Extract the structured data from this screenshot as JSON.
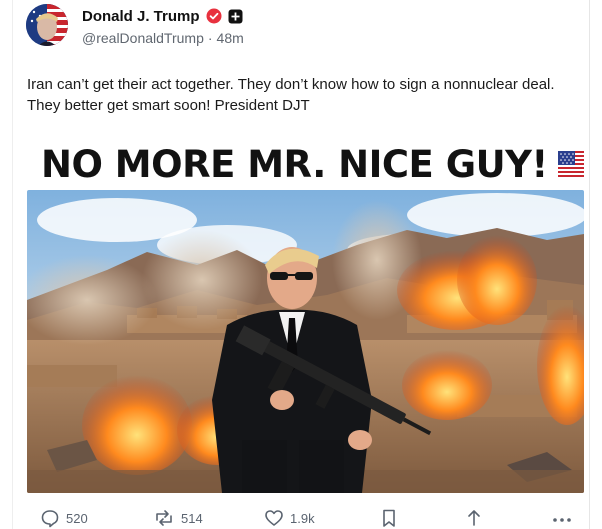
{
  "post": {
    "author": {
      "display_name": "Donald J. Trump",
      "handle": "@realDonaldTrump",
      "separator": "·",
      "time_ago": "48m",
      "verified": true
    },
    "text": "Iran can’t get their act together. They don’t know how to sign a nonnuclear deal. They better get smart soon! President DJT",
    "media": {
      "headline": "NO MORE MR. NICE GUY!",
      "flag_icon": "us-flag-icon",
      "image_icon": "photo-illustration"
    },
    "actions": {
      "replies": "520",
      "reposts": "514",
      "likes": "1.9k"
    }
  },
  "colors": {
    "verified_badge": "#e8313e",
    "meta_text": "#606770",
    "action_icon": "#5b6470"
  }
}
